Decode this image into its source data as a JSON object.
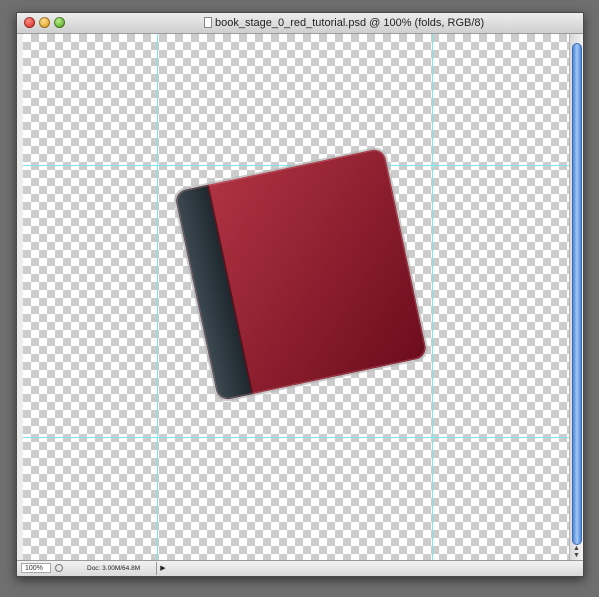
{
  "window": {
    "title": "book_stage_0_red_tutorial.psd @ 100% (folds, RGB/8)"
  },
  "status": {
    "zoom": "100%",
    "doc_info": "Doc: 3.00M/64.8M"
  },
  "colors": {
    "cover_light": "#b53645",
    "cover_dark": "#6c0c1d",
    "spine": "#263238",
    "guide": "#7fe6ee"
  },
  "icons": {
    "close": "close-icon",
    "minimize": "minimize-icon",
    "zoom": "zoom-icon",
    "document": "document-icon"
  }
}
